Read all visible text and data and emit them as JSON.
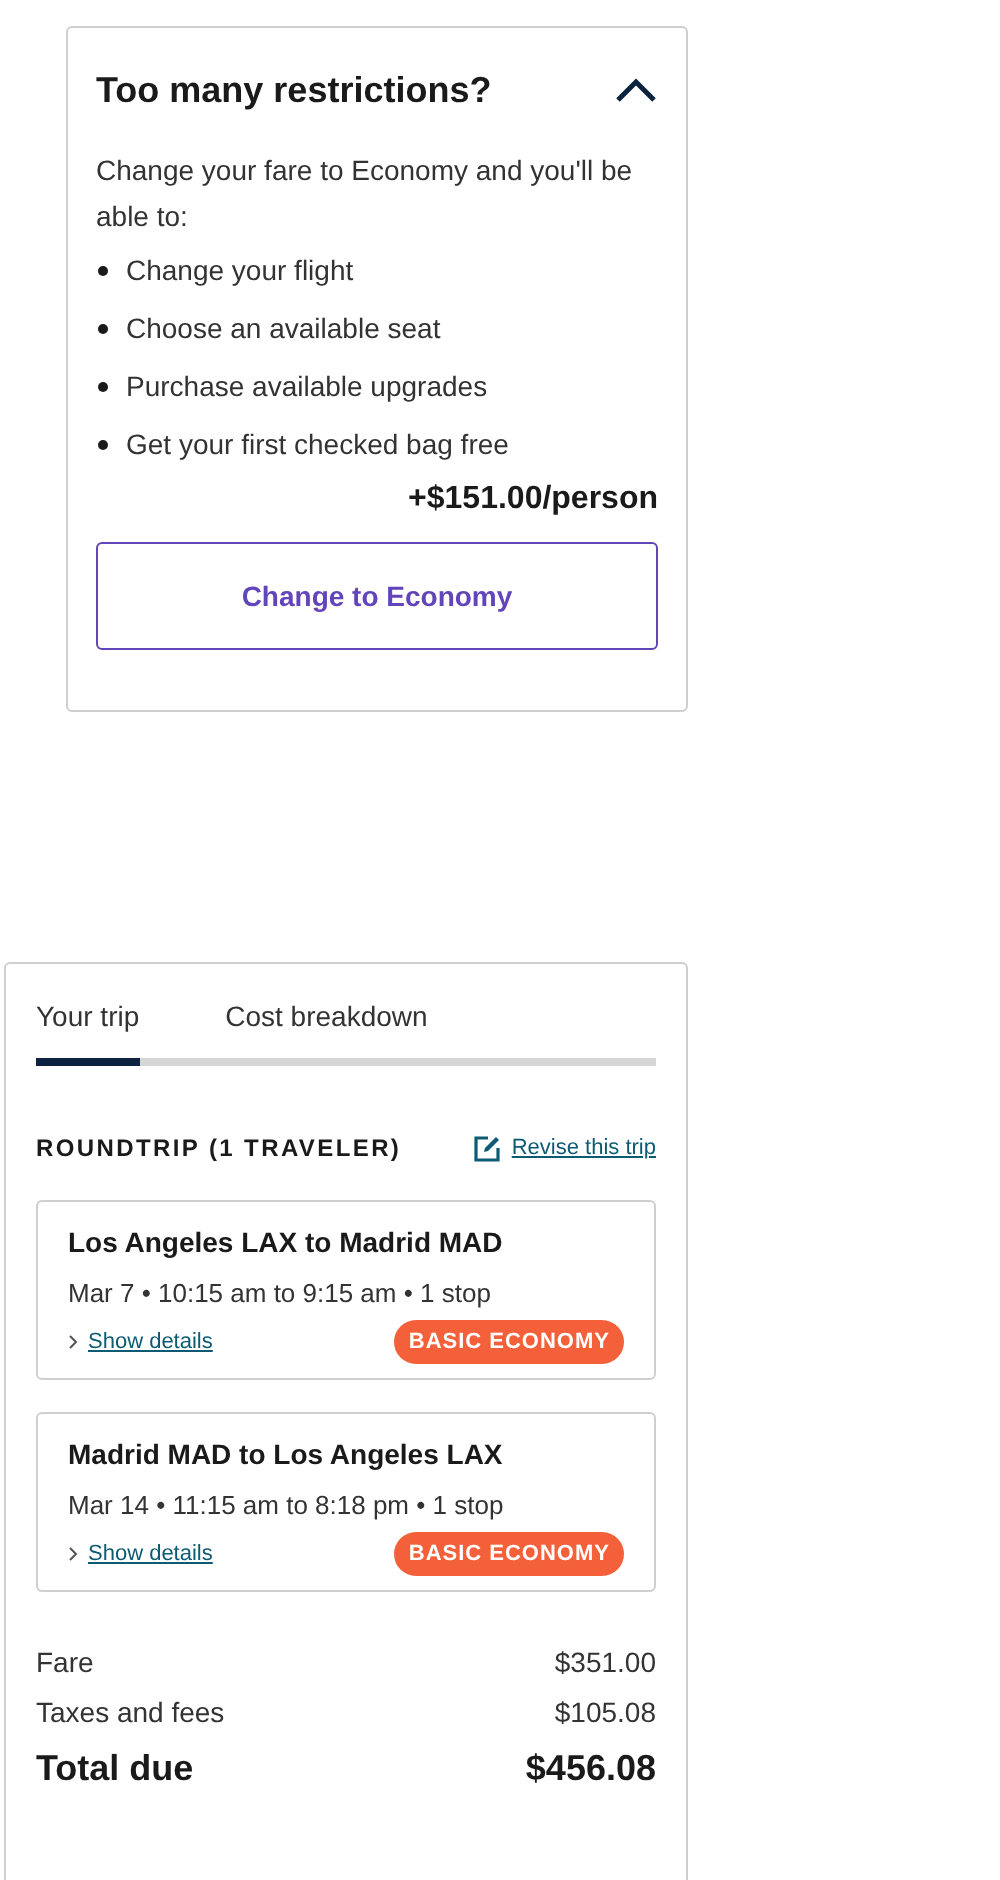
{
  "upgrade_panel": {
    "title": "Too many restrictions?",
    "expanded": true,
    "intro": "Change your fare to Economy and you'll be able to:",
    "benefits": [
      "Change your flight",
      "Choose an available seat",
      "Purchase available upgrades",
      "Get your first checked bag free"
    ],
    "price": "+$151.00/person",
    "button": "Change to Economy"
  },
  "trip_panel": {
    "tabs": [
      {
        "label": "Your trip",
        "selected": true
      },
      {
        "label": "Cost breakdown",
        "selected": false
      }
    ],
    "heading": "ROUNDTRIP (1 TRAVELER)",
    "revise_link": "Revise this trip",
    "flights": [
      {
        "route": "Los Angeles LAX to Madrid MAD",
        "details": "Mar 7 • 10:15 am to 9:15 am • 1 stop",
        "link": "Show details",
        "badge": "BASIC ECONOMY"
      },
      {
        "route": "Madrid MAD to Los Angeles LAX",
        "details": "Mar 14 • 11:15 am to 8:18 pm • 1 stop",
        "link": "Show details",
        "badge": "BASIC ECONOMY"
      }
    ],
    "costs": [
      {
        "kind": "line",
        "label": "Fare",
        "amount": "$351.00"
      },
      {
        "kind": "line",
        "label": "Taxes and fees",
        "amount": "$105.08"
      },
      {
        "kind": "total",
        "label": "Total due",
        "amount": "$456.08"
      }
    ]
  }
}
